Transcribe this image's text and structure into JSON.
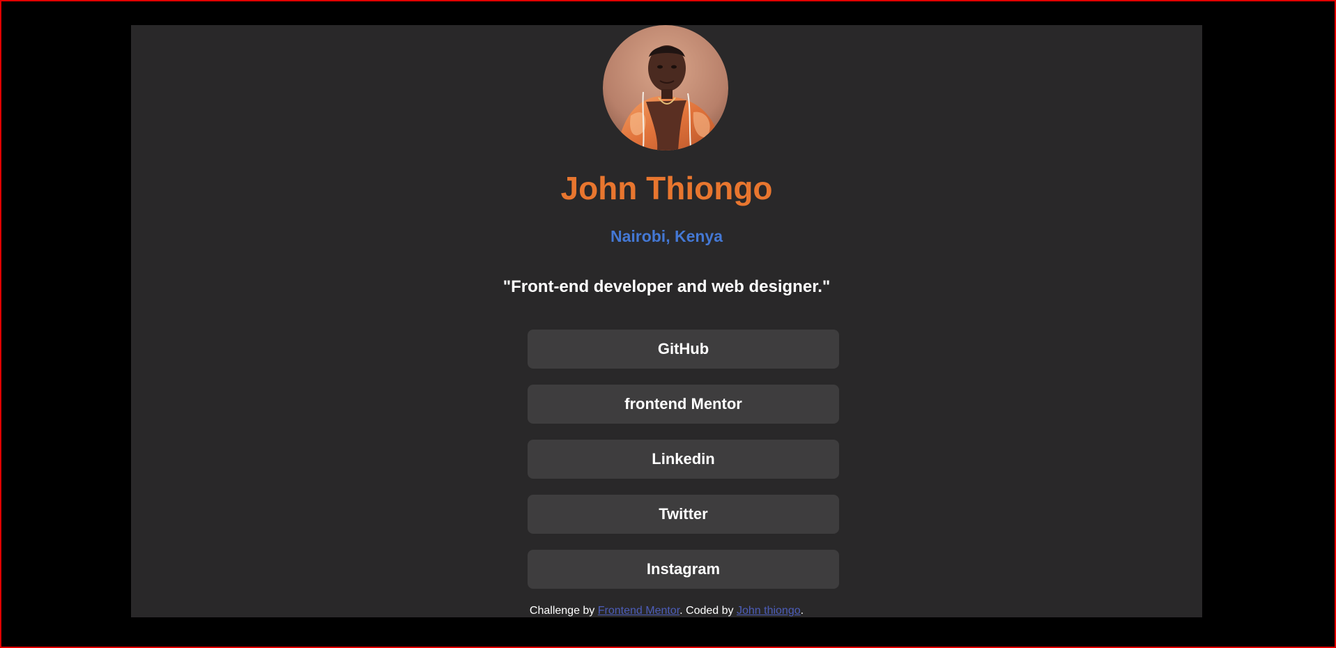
{
  "profile": {
    "name": "John Thiongo",
    "location": "Nairobi, Kenya",
    "bio": "\"Front-end developer and web designer.\""
  },
  "links": [
    {
      "label": "GitHub"
    },
    {
      "label": "frontend Mentor"
    },
    {
      "label": "Linkedin"
    },
    {
      "label": "Twitter"
    },
    {
      "label": "Instagram"
    }
  ],
  "footer": {
    "prefix": "Challenge by ",
    "challenge_link": "Frontend Mentor",
    "middle": ". Coded by ",
    "author_link": "John thiongo",
    "suffix": "."
  },
  "colors": {
    "page_background": "#000000",
    "card_background": "#292829",
    "button_background": "#3e3d3e",
    "name_accent": "#e8762f",
    "location_accent": "#4478d4",
    "footer_link": "#4c5db8",
    "frame_border": "#e00000"
  }
}
